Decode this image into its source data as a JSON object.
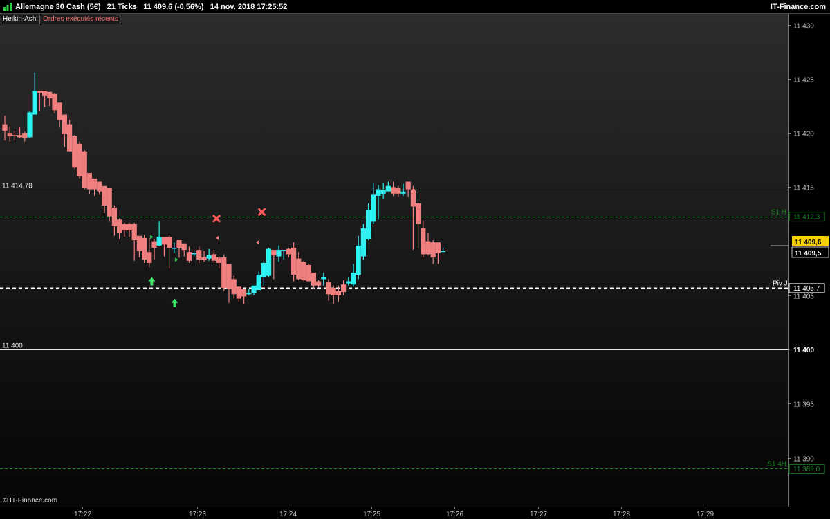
{
  "header": {
    "instrument": "Allemagne 30 Cash (5€)",
    "period": "21 Ticks",
    "quote": "11 409,6 (-0,56%)",
    "datetime": "14 nov. 2018 17:25:52",
    "brand": "IT-Finance.com"
  },
  "tags": {
    "chart_style": "Heikin-Ashi",
    "orders": "Ordres exécutés récents"
  },
  "footer": {
    "copyright": "© IT-Finance.com"
  },
  "colors": {
    "bull": "#2ef2f2",
    "bear": "#f08080",
    "up_arrow": "#3fe86a",
    "cross": "#ff5a5a",
    "support": "#1f8a2a"
  },
  "chart_data": {
    "type": "candlestick",
    "style": "Heikin-Ashi",
    "ylim": [
      11385.5,
      11431
    ],
    "y_ticks": [
      {
        "value": 11390,
        "label": "11 390"
      },
      {
        "value": 11395,
        "label": "11 395"
      },
      {
        "value": 11400,
        "label": "11 400"
      },
      {
        "value": 11405,
        "label": "11 405"
      },
      {
        "value": 11410,
        "label": "11 410"
      },
      {
        "value": 11415,
        "label": "11 415"
      },
      {
        "value": 11420,
        "label": "11 420"
      },
      {
        "value": 11425,
        "label": "11 425"
      },
      {
        "value": 11430,
        "label": "11 430"
      }
    ],
    "x_ticks": [
      {
        "label": "17:22",
        "bar": 15.5
      },
      {
        "label": "17:23",
        "bar": 38.6
      },
      {
        "label": "17:24",
        "bar": 56.8
      },
      {
        "label": "17:25",
        "bar": 73.6
      },
      {
        "label": "17:26",
        "bar": 90.3
      },
      {
        "label": "17:27",
        "bar": 107.1
      },
      {
        "label": "17:28",
        "bar": 123.8
      },
      {
        "label": "17:29",
        "bar": 140.6
      }
    ],
    "candles": [
      [
        11420.8,
        11420.2,
        11421.6,
        11419.3
      ],
      [
        11420.0,
        11419.7,
        11420.6,
        11419.2
      ],
      [
        11419.8,
        11419.7,
        11420.2,
        11419.3
      ],
      [
        11419.8,
        11419.6,
        11420.5,
        11419.5
      ],
      [
        11420.0,
        11419.5,
        11420.1,
        11419.2
      ],
      [
        11419.6,
        11421.9,
        11422.0,
        11419.5
      ],
      [
        11421.7,
        11423.9,
        11425.6,
        11421.7
      ],
      [
        11423.9,
        11423.7,
        11423.9,
        11422.0
      ],
      [
        11423.9,
        11423.4,
        11423.8,
        11422.4
      ],
      [
        11423.8,
        11423.2,
        11423.7,
        11422.5
      ],
      [
        11423.6,
        11422.1,
        11423.7,
        11421.8
      ],
      [
        11422.8,
        11421.2,
        11422.5,
        11420.5
      ],
      [
        11421.7,
        11419.9,
        11420.9,
        11418.7
      ],
      [
        11420.8,
        11418.3,
        11421.2,
        11418.4
      ],
      [
        11419.7,
        11416.8,
        11419.8,
        11416.7
      ],
      [
        11419.0,
        11416.0,
        11419.2,
        11415.8
      ],
      [
        11418.3,
        11414.9,
        11418.4,
        11414.8
      ],
      [
        11416.3,
        11414.8,
        11416.1,
        11414.4
      ],
      [
        11415.8,
        11414.8,
        11415.5,
        11414.2
      ],
      [
        11415.5,
        11414.6,
        11415.4,
        11414.3
      ],
      [
        11415.1,
        11413.3,
        11414.9,
        11412.6
      ],
      [
        11414.9,
        11412.3,
        11414.9,
        11411.8
      ],
      [
        11413.1,
        11411.4,
        11413.3,
        11410.5
      ],
      [
        11412.0,
        11410.8,
        11412.1,
        11410.2
      ],
      [
        11411.6,
        11411.0,
        11411.7,
        11410.4
      ],
      [
        11411.6,
        11411.0,
        11411.7,
        11410.4
      ],
      [
        11411.6,
        11410.1,
        11411.7,
        11408.2
      ],
      [
        11410.5,
        11409.1,
        11410.5,
        11408.5
      ],
      [
        11410.3,
        11408.3,
        11410.6,
        11408.0
      ],
      [
        11409.0,
        11408.0,
        11410.3,
        11407.6
      ],
      [
        11410.0,
        11409.4,
        11410.2,
        11408.3
      ],
      [
        11409.6,
        11410.4,
        11411.8,
        11409.6
      ],
      [
        11410.4,
        11409.7,
        11410.4,
        11408.6
      ],
      [
        11410.4,
        11409.4,
        11410.6,
        11407.5
      ],
      [
        11409.3,
        11409.4,
        11409.9,
        11408.9
      ],
      [
        11410.1,
        11409.4,
        11410.1,
        11408.5
      ],
      [
        11409.8,
        11409.2,
        11409.8,
        11408.6
      ],
      [
        11409.0,
        11408.2,
        11409.5,
        11408.0
      ],
      [
        11408.8,
        11408.9,
        11409.2,
        11408.6
      ],
      [
        11409.2,
        11408.3,
        11409.5,
        11408.0
      ],
      [
        11408.5,
        11408.3,
        11409.1,
        11408.1
      ],
      [
        11408.4,
        11408.7,
        11409.3,
        11408.2
      ],
      [
        11408.8,
        11408.2,
        11409.2,
        11408.0
      ],
      [
        11408.5,
        11408.0,
        11408.6,
        11407.5
      ],
      [
        11408.5,
        11405.7,
        11408.8,
        11405.4
      ],
      [
        11407.9,
        11405.6,
        11407.9,
        11404.3
      ],
      [
        11406.5,
        11405.1,
        11406.8,
        11404.7
      ],
      [
        11405.8,
        11404.7,
        11405.8,
        11404.4
      ],
      [
        11405.6,
        11404.9,
        11405.6,
        11404.2
      ],
      [
        11405.1,
        11405.2,
        11405.6,
        11405.0
      ],
      [
        11405.2,
        11405.9,
        11405.9,
        11405.0
      ],
      [
        11405.5,
        11406.9,
        11407.2,
        11405.5
      ],
      [
        11406.7,
        11408.0,
        11408.2,
        11405.9
      ],
      [
        11406.8,
        11409.3,
        11409.4,
        11406.7
      ],
      [
        11409.2,
        11408.7,
        11409.2,
        11406.5
      ],
      [
        11408.6,
        11409.2,
        11409.6,
        11408.1
      ],
      [
        11409.1,
        11409.2,
        11409.2,
        11408.3
      ],
      [
        11409.3,
        11408.8,
        11409.4,
        11408.5
      ],
      [
        11409.4,
        11406.9,
        11409.9,
        11406.3
      ],
      [
        11408.4,
        11406.5,
        11409.0,
        11406.4
      ],
      [
        11408.1,
        11406.4,
        11408.2,
        11406.3
      ],
      [
        11407.8,
        11406.3,
        11407.9,
        11406.3
      ],
      [
        11407.1,
        11405.9,
        11407.1,
        11405.6
      ],
      [
        11406.3,
        11405.9,
        11406.4,
        11405.7
      ],
      [
        11406.5,
        11406.7,
        11407.1,
        11405.9
      ],
      [
        11406.2,
        11405.1,
        11406.5,
        11404.5
      ],
      [
        11405.7,
        11405.0,
        11405.9,
        11404.2
      ],
      [
        11405.4,
        11405.0,
        11405.9,
        11404.4
      ],
      [
        11406.0,
        11405.3,
        11406.4,
        11405.0
      ],
      [
        11406.1,
        11406.3,
        11406.7,
        11405.9
      ],
      [
        11406.0,
        11407.1,
        11407.9,
        11405.8
      ],
      [
        11406.9,
        11409.6,
        11410.5,
        11406.5
      ],
      [
        11408.6,
        11411.2,
        11411.6,
        11408.3
      ],
      [
        11410.2,
        11412.9,
        11413.5,
        11410.1
      ],
      [
        11411.8,
        11414.3,
        11415.4,
        11411.6
      ],
      [
        11414.2,
        11414.8,
        11415.2,
        11412.0
      ],
      [
        11414.4,
        11414.7,
        11415.4,
        11413.9
      ],
      [
        11414.6,
        11415.1,
        11415.5,
        11414.7
      ],
      [
        11415.0,
        11414.4,
        11415.5,
        11414.2
      ],
      [
        11414.9,
        11414.4,
        11415.1,
        11414.1
      ],
      [
        11414.4,
        11414.6,
        11415.3,
        11414.2
      ],
      [
        11415.5,
        11414.8,
        11415.5,
        11414.1
      ],
      [
        11414.8,
        11413.2,
        11415.1,
        11409.2
      ],
      [
        11413.5,
        11411.6,
        11413.5,
        11409.3
      ],
      [
        11411.2,
        11408.8,
        11411.9,
        11408.5
      ],
      [
        11410.0,
        11408.8,
        11410.8,
        11408.7
      ],
      [
        11409.9,
        11408.5,
        11410.1,
        11407.9
      ],
      [
        11409.9,
        11408.9,
        11409.6,
        11407.9
      ],
      [
        11409.1,
        11409.1,
        11409.4,
        11409.0
      ]
    ],
    "signals": [
      {
        "type": "buy-arrow",
        "bar": 29.5,
        "price": 11406.3
      },
      {
        "type": "buy-arrow",
        "bar": 34.1,
        "price": 11404.3
      },
      {
        "type": "buy-tick",
        "bar": 29.2,
        "price": 11410.4
      },
      {
        "type": "buy-tick",
        "bar": 34.2,
        "price": 11408.3
      },
      {
        "type": "sell-cross",
        "bar": 42.5,
        "price": 11412.1
      },
      {
        "type": "sell-cross",
        "bar": 51.6,
        "price": 11412.7
      },
      {
        "type": "sell-tick",
        "bar": 42.9,
        "price": 11410.3
      },
      {
        "type": "sell-tick",
        "bar": 51.0,
        "price": 11409.9
      }
    ],
    "levels": [
      {
        "kind": "solid",
        "price": 11414.78,
        "label": "11 414,78"
      },
      {
        "kind": "solid",
        "price": 11400,
        "label": "11 400",
        "axis_label": "11 400"
      },
      {
        "kind": "dash-white",
        "price": 11405.7,
        "tag": "Piv J",
        "axis_label": "11 405,7"
      },
      {
        "kind": "dash-green",
        "price": 11412.3,
        "tag": "S1 H",
        "axis_label": "11 412,3"
      },
      {
        "kind": "dash-green",
        "price": 11389.0,
        "tag": "S1 4H",
        "axis_label": "11 389,0"
      }
    ],
    "price_badges": [
      {
        "value": "11 409,6",
        "style": "last"
      },
      {
        "value": "11 409,5",
        "style": "bid"
      }
    ]
  }
}
